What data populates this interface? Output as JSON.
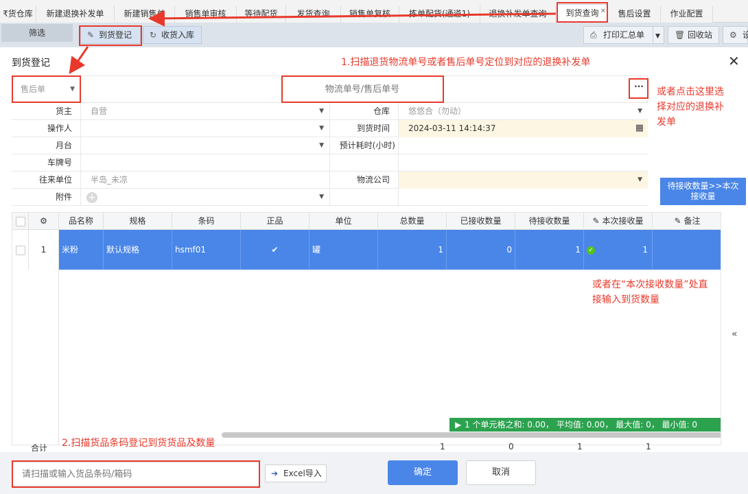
{
  "tabs": [
    {
      "label": "₹货仓库"
    },
    {
      "label": "新建退换补发单"
    },
    {
      "label": "新建销售单"
    },
    {
      "label": "销售单审核"
    },
    {
      "label": "等待配货"
    },
    {
      "label": "发货查询"
    },
    {
      "label": "销售单复核"
    },
    {
      "label": "拣单配货(通道1)"
    },
    {
      "label": "退换补发单查询"
    },
    {
      "label": "到货查询"
    },
    {
      "label": "售后设置"
    },
    {
      "label": "作业配置"
    }
  ],
  "toolbar": {
    "filter": "筛选",
    "arrival_register": "到货登记",
    "receive_stock": "收货入库",
    "print_summary": "打印汇总单",
    "recycle_bin": "回收站",
    "settings": "设"
  },
  "modal": {
    "title": "到货登记",
    "select_type": "售后单",
    "search_placeholder": "物流单号/售后单号",
    "dots": "···"
  },
  "form": {
    "owner_label": "货主",
    "owner_value": "自营",
    "warehouse_label": "仓库",
    "warehouse_value": "悠悠合（勿动）",
    "operator_label": "操作人",
    "operator_value": "",
    "arrival_time_label": "到货时间",
    "arrival_time_value": "2024-03-11 14:14:37",
    "platform_label": "月台",
    "platform_value": "",
    "est_time_label": "预计耗时(小时)",
    "est_time_value": "",
    "plate_label": "车牌号",
    "plate_value": "",
    "partner_label": "往来单位",
    "partner_value": "半岛_未凉",
    "logistics_label": "物流公司",
    "logistics_value": "",
    "attachment_label": "附件"
  },
  "pending_button": {
    "line1": "待接收数量>>本次",
    "line2": "接收量"
  },
  "grid": {
    "headers": [
      "品名称",
      "规格",
      "条码",
      "正品",
      "单位",
      "总数量",
      "已接收数量",
      "待接收数量",
      "本次接收量",
      "备注"
    ],
    "row": {
      "index": "1",
      "name": "米粉",
      "spec": "默认规格",
      "barcode": "hsmf01",
      "unit": "罐",
      "total": "1",
      "received": "0",
      "pending": "1",
      "this_time": "1",
      "remark": ""
    },
    "status_text": "1 个单元格之和: 0.00， 平均值: 0.00， 最大值: 0， 最小值: 0",
    "sum_label": "合计",
    "sums": [
      "1",
      "0",
      "1",
      "1"
    ]
  },
  "footer": {
    "barcode_placeholder": "请扫描或输入货品条码/箱码",
    "excel_import": "Excel导入",
    "confirm": "确定",
    "cancel": "取消"
  },
  "annotations": {
    "step1": "1.扫描退货物流单号或者售后单号定位到对应的退换补发单",
    "alt_select_line1": "或者点击这里选",
    "alt_select_line2": "择对应的退换补",
    "alt_select_line3": "发单",
    "alt_input_line1": "或者在“本次接收数量”处直",
    "alt_input_line2": "接输入到货数量",
    "step2": "2.扫描货品条码登记到货货品及数量"
  },
  "colors": {
    "accent": "#4a86e8",
    "annotation": "#e8392b",
    "status_green": "#2ca24f"
  }
}
